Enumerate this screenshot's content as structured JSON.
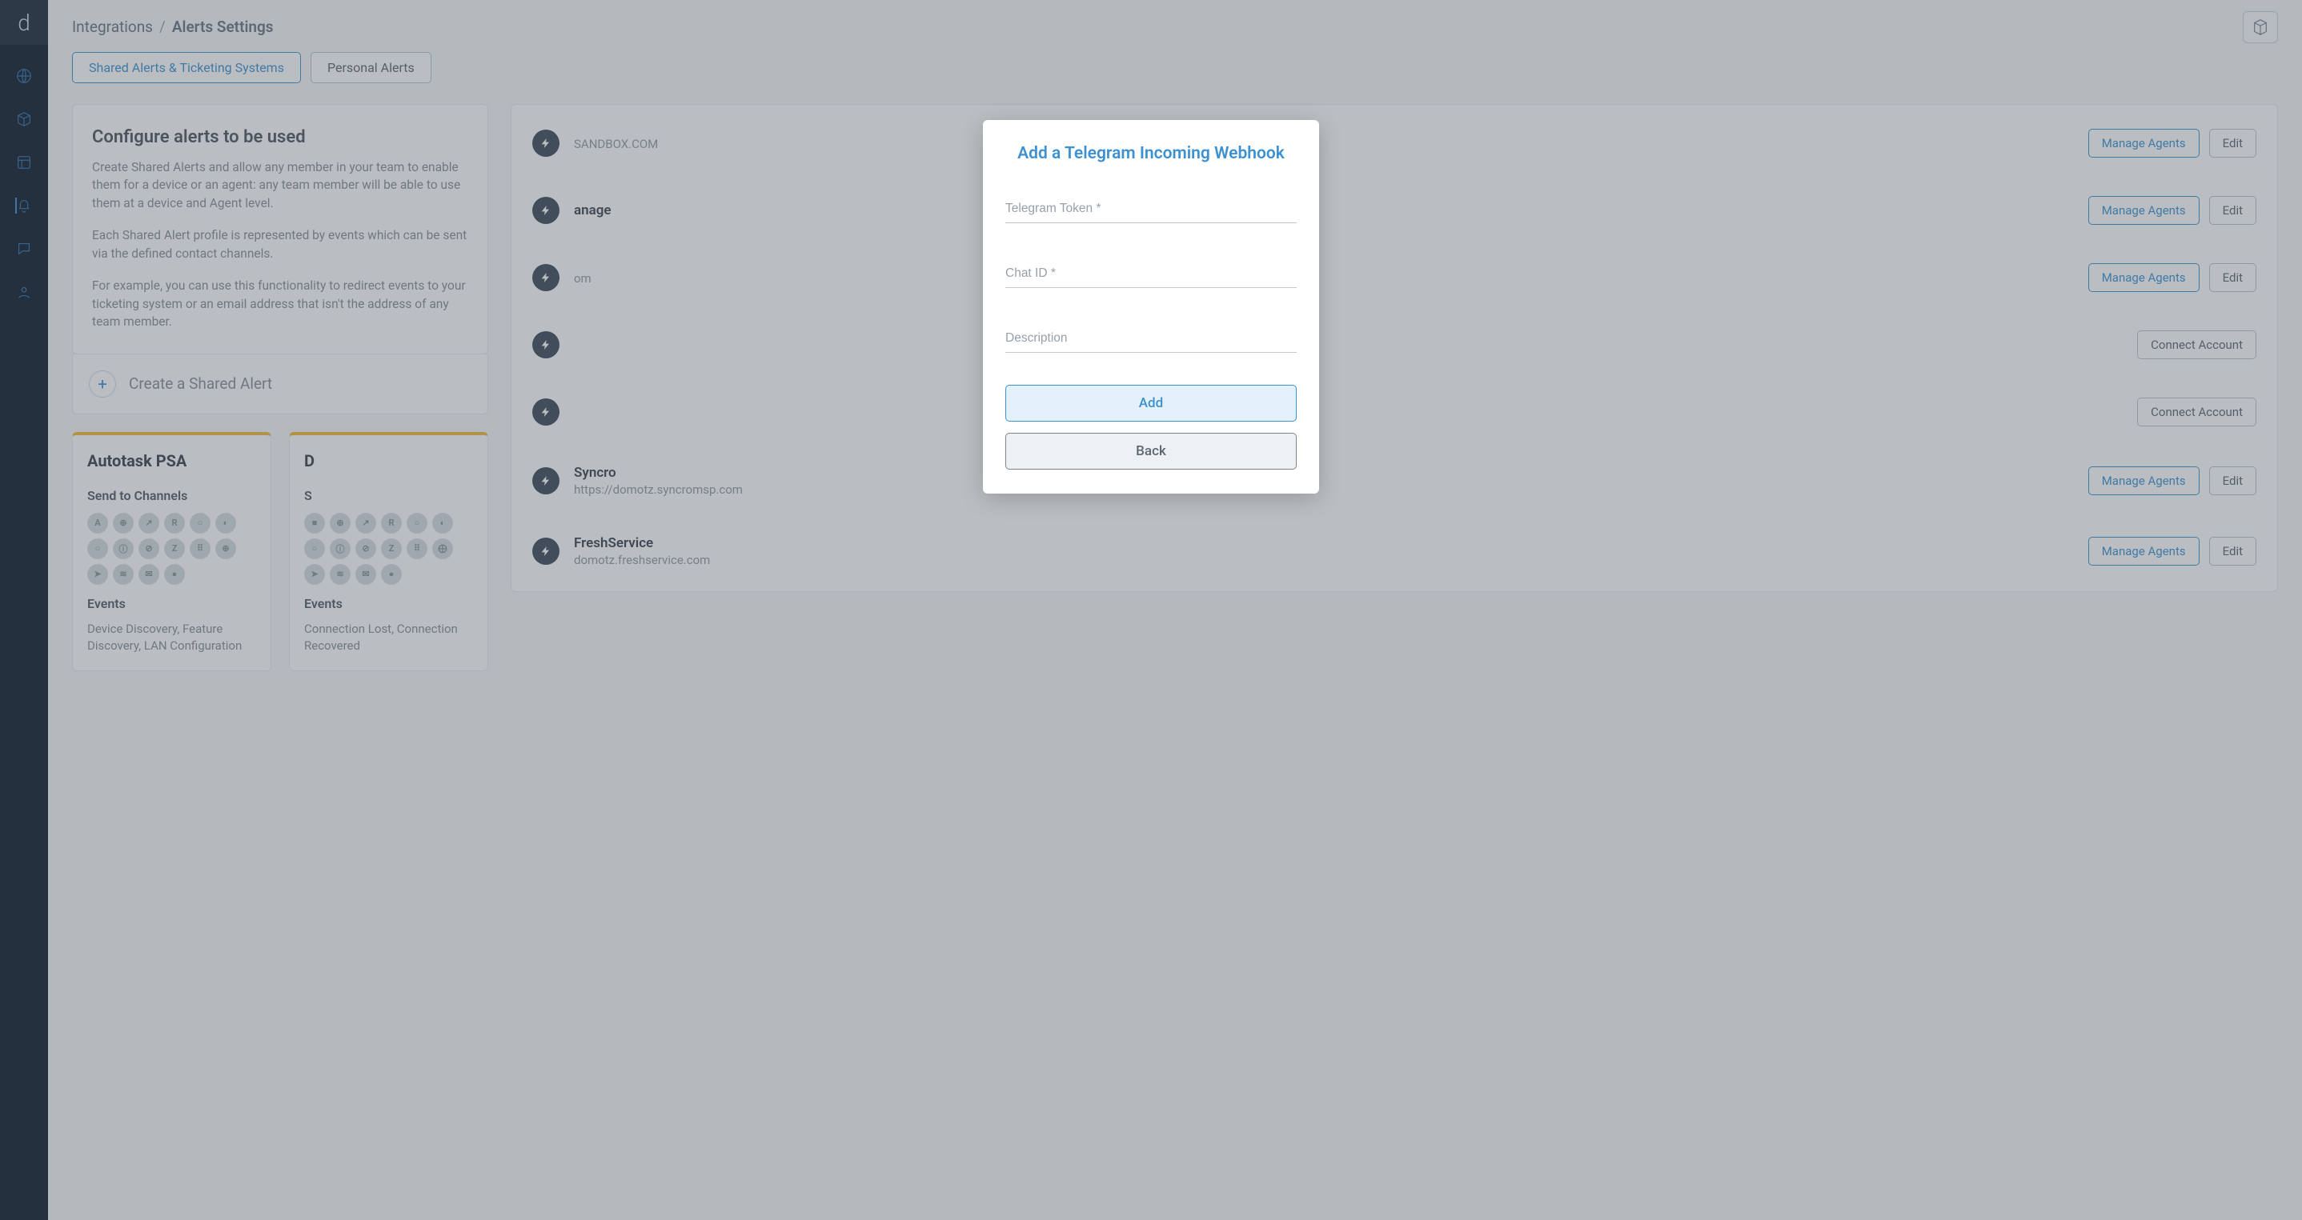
{
  "breadcrumb": {
    "parent": "Integrations",
    "current": "Alerts Settings"
  },
  "tabs": {
    "shared": "Shared Alerts & Ticketing Systems",
    "personal": "Personal Alerts"
  },
  "info": {
    "heading": "Configure alerts to be used",
    "p1": "Create Shared Alerts and allow any member in your team to enable them for a device or an agent: any team member will be able to use them at a device and Agent level.",
    "p2": "Each Shared Alert profile is represented by events which can be sent via the defined contact channels.",
    "p3": "For example, you can use this functionality to redirect events to your ticketing system or an email address that isn't the address of any team member."
  },
  "create": {
    "label": "Create a Shared Alert"
  },
  "cards": [
    {
      "title": "Autotask PSA",
      "channels_label": "Send to Channels",
      "chips": [
        "A",
        "⊕",
        "↗",
        "R",
        "○",
        "◐",
        "○",
        "ⓘ",
        "⊘",
        "Z",
        "⠿",
        "⊕",
        "➤",
        "≋",
        "✉",
        "●"
      ],
      "events_label": "Events",
      "events_text": "Device Discovery, Feature Discovery, LAN Configuration"
    },
    {
      "title": "D",
      "channels_label": "S",
      "chips": [
        "■",
        "⊕",
        "↗",
        "R",
        "○",
        "◐",
        "○",
        "ⓘ",
        "⊘",
        "Z",
        "⠿",
        "⨁",
        "➤",
        "≋",
        "✉",
        "●"
      ],
      "events_label": "Events",
      "events_text": "Connection Lost, Connection Recovered"
    }
  ],
  "integrations": [
    {
      "name": "",
      "sub": "SANDBOX.COM",
      "actions": [
        "Manage Agents",
        "Edit"
      ]
    },
    {
      "name": "anage",
      "sub": "",
      "actions": [
        "Manage Agents",
        "Edit"
      ]
    },
    {
      "name": "",
      "sub": "om",
      "actions": [
        "Manage Agents",
        "Edit"
      ]
    },
    {
      "name": "",
      "sub": "",
      "actions": [
        "Connect Account"
      ]
    },
    {
      "name": "",
      "sub": "",
      "actions": [
        "Connect Account"
      ]
    },
    {
      "name": "Syncro",
      "sub": "https://domotz.syncromsp.com",
      "actions": [
        "Manage Agents",
        "Edit"
      ]
    },
    {
      "name": "FreshService",
      "sub": "domotz.freshservice.com",
      "actions": [
        "Manage Agents",
        "Edit"
      ]
    }
  ],
  "modal": {
    "title": "Add a Telegram Incoming Webhook",
    "token_ph": "Telegram Token *",
    "chatid_ph": "Chat ID *",
    "desc_ph": "Description",
    "add": "Add",
    "back": "Back"
  }
}
